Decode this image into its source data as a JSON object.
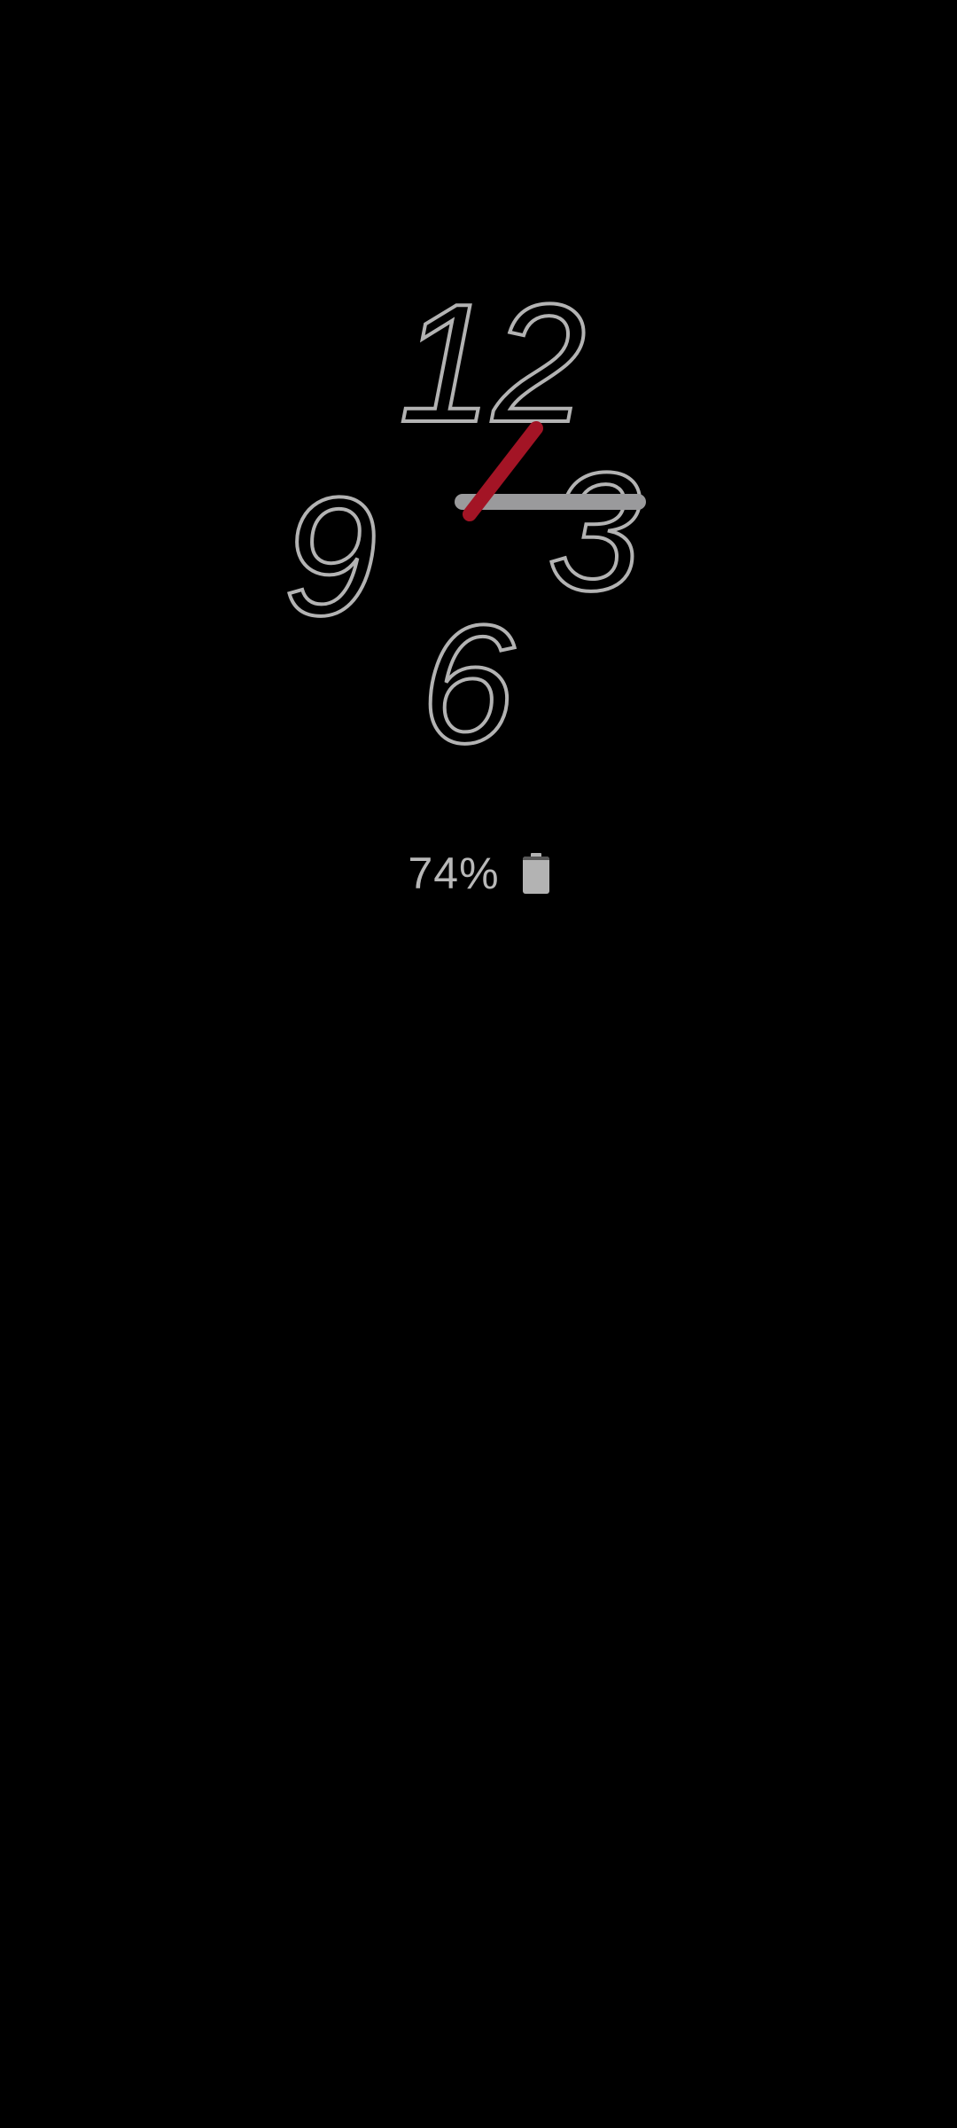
{
  "clock": {
    "numerals": {
      "twelve": "12",
      "three": "3",
      "six": "6",
      "nine": "9"
    },
    "hour_hand_color": "#a31425",
    "minute_hand_color": "#9a9a9c",
    "numeral_outline_color": "#b3b3b3"
  },
  "battery": {
    "label": "74%",
    "level": 0.74,
    "icon": "battery-icon"
  }
}
